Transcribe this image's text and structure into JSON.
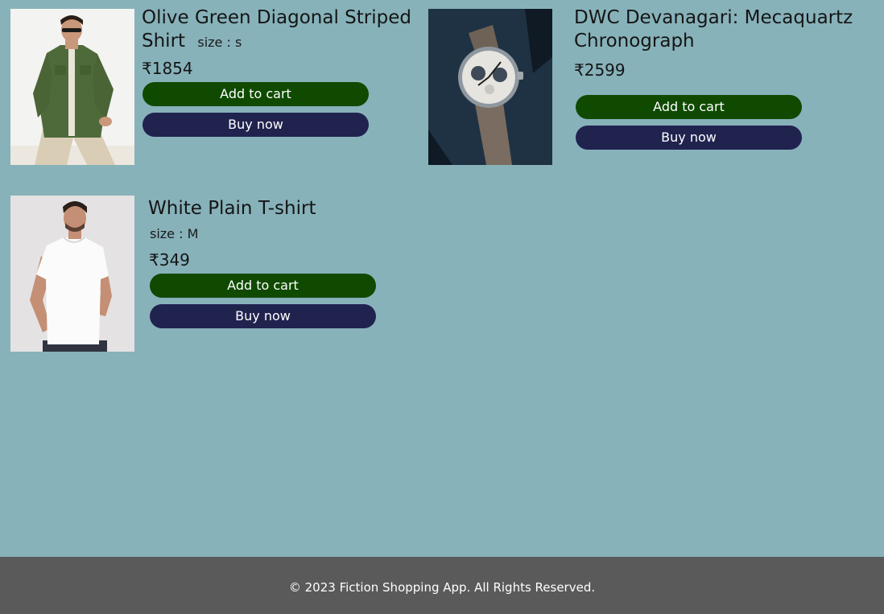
{
  "products": [
    {
      "title": "Olive Green Diagonal Striped Shirt",
      "size_text": "size : s",
      "price": "₹1854",
      "add_to_cart_label": "Add to cart",
      "buy_now_label": "Buy now",
      "image": "man-in-olive-green-shirt-photo"
    },
    {
      "title": "DWC Devanagari: Mecaquartz Chronograph",
      "price": "₹2599",
      "add_to_cart_label": "Add to cart",
      "buy_now_label": "Buy now",
      "image": "chronograph-wristwatch-photo"
    },
    {
      "title": "White Plain T-shirt",
      "size_text": "size : M",
      "price": "₹349",
      "add_to_cart_label": "Add to cart",
      "buy_now_label": "Buy now",
      "image": "man-in-white-tshirt-photo"
    }
  ],
  "footer": {
    "copyright": "© 2023 Fiction Shopping App. All Rights Reserved."
  },
  "colors": {
    "page_background": "#87b2ba",
    "add_to_cart": "#0f4a00",
    "buy_now": "#21234f",
    "footer_background": "#5a5a5b"
  }
}
